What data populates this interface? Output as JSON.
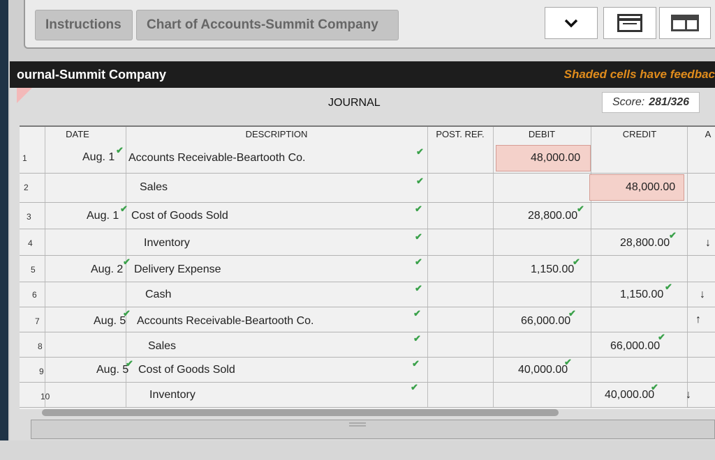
{
  "tabs": [
    {
      "label": "Instructions"
    },
    {
      "label": "Chart of Accounts-Summit Company"
    }
  ],
  "panel": {
    "title": "ournal-Summit Company",
    "feedback_note": "Shaded cells have feedbac",
    "journal_label": "JOURNAL",
    "score_label": "Score:",
    "score_value": "281/326"
  },
  "columns": {
    "date": "DATE",
    "description": "DESCRIPTION",
    "post_ref": "POST. REF.",
    "debit": "DEBIT",
    "credit": "CREDIT",
    "extra": "A"
  },
  "rows": [
    {
      "num": "1",
      "date": "Aug. 1",
      "desc": "Accounts Receivable-Beartooth Co.",
      "debit": "48,000.00",
      "credit": ""
    },
    {
      "num": "2",
      "date": "",
      "desc": "Sales",
      "debit": "",
      "credit": "48,000.00"
    },
    {
      "num": "3",
      "date": "Aug. 1",
      "desc": "Cost of Goods Sold",
      "debit": "28,800.00",
      "credit": ""
    },
    {
      "num": "4",
      "date": "",
      "desc": "Inventory",
      "debit": "",
      "credit": "28,800.00"
    },
    {
      "num": "5",
      "date": "Aug. 2",
      "desc": "Delivery Expense",
      "debit": "1,150.00",
      "credit": ""
    },
    {
      "num": "6",
      "date": "",
      "desc": "Cash",
      "debit": "",
      "credit": "1,150.00"
    },
    {
      "num": "7",
      "date": "Aug. 5",
      "desc": "Accounts Receivable-Beartooth Co.",
      "debit": "66,000.00",
      "credit": ""
    },
    {
      "num": "8",
      "date": "",
      "desc": "Sales",
      "debit": "",
      "credit": "66,000.00"
    },
    {
      "num": "9",
      "date": "Aug. 5",
      "desc": "Cost of Goods Sold",
      "debit": "40,000.00",
      "credit": ""
    },
    {
      "num": "10",
      "date": "",
      "desc": "Inventory",
      "debit": "",
      "credit": "40,000.00"
    }
  ],
  "icons": {
    "check": "checkmark-icon",
    "chevron": "chevron-down-icon",
    "down": "arrow-down-icon",
    "up": "arrow-up-icon"
  },
  "colors": {
    "shaded_cell": "#f4d1ca",
    "check": "#3aa14a",
    "feedback_text": "#e08c1c",
    "title_bar": "#1d1d1d"
  }
}
